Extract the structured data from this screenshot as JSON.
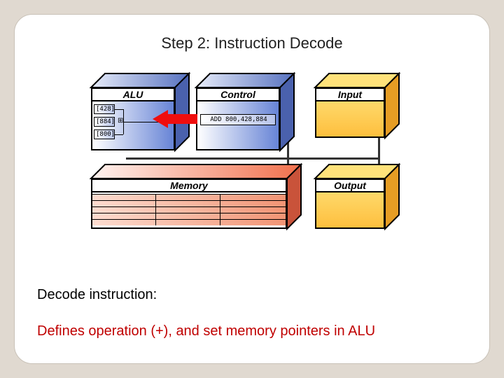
{
  "title": "Step 2: Instruction Decode",
  "blocks": {
    "alu": {
      "label": "ALU",
      "registers": [
        "[428]",
        "[884]",
        "[800]"
      ],
      "op_glyph": "⊞"
    },
    "control": {
      "label": "Control",
      "instruction": "ADD 800,428,884"
    },
    "input": {
      "label": "Input"
    },
    "output": {
      "label": "Output"
    },
    "memory": {
      "label": "Memory"
    }
  },
  "body": {
    "line1": "Decode instruction:",
    "line2": "Defines operation (+), and set memory pointers in ALU"
  }
}
